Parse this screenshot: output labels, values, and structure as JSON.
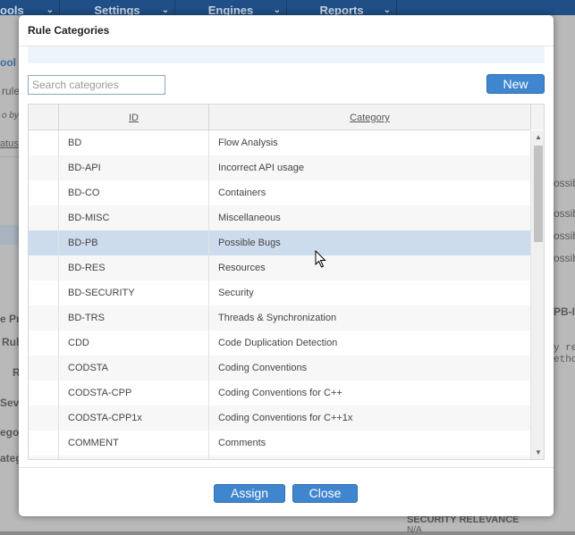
{
  "background": {
    "nav_items": [
      {
        "label": "ools"
      },
      {
        "label": "Settings"
      },
      {
        "label": "Engines"
      },
      {
        "label": "Reports"
      }
    ],
    "left_fragments": [
      "ool fi",
      "rule",
      "o by",
      "atus",
      "e Pr",
      "Rul",
      "R",
      "Sev",
      "egor",
      "ateg"
    ],
    "right_fragments": [
      "ossib",
      "ossib",
      "ossib",
      "ossib",
      "PB-IN",
      "y re",
      "etho",
      "SECURITY RELEVANCE",
      "N/A"
    ]
  },
  "modal": {
    "title": "Rule Categories",
    "search": {
      "placeholder": "Search categories",
      "value": ""
    },
    "new_button": "New",
    "assign_button": "Assign",
    "close_button": "Close",
    "columns": {
      "id": "ID",
      "category": "Category"
    },
    "rows": [
      {
        "id": "BD",
        "category": "Flow Analysis",
        "selected": false
      },
      {
        "id": "BD-API",
        "category": "Incorrect API usage",
        "selected": false
      },
      {
        "id": "BD-CO",
        "category": "Containers",
        "selected": false
      },
      {
        "id": "BD-MISC",
        "category": "Miscellaneous",
        "selected": false
      },
      {
        "id": "BD-PB",
        "category": "Possible Bugs",
        "selected": true
      },
      {
        "id": "BD-RES",
        "category": "Resources",
        "selected": false
      },
      {
        "id": "BD-SECURITY",
        "category": "Security",
        "selected": false
      },
      {
        "id": "BD-TRS",
        "category": "Threads & Synchronization",
        "selected": false
      },
      {
        "id": "CDD",
        "category": "Code Duplication Detection",
        "selected": false
      },
      {
        "id": "CODSTA",
        "category": "Coding Conventions",
        "selected": false
      },
      {
        "id": "CODSTA-CPP",
        "category": "Coding Conventions for C++",
        "selected": false
      },
      {
        "id": "CODSTA-CPP1x",
        "category": "Coding Conventions for C++1x",
        "selected": false
      },
      {
        "id": "COMMENT",
        "category": "Comments",
        "selected": false
      },
      {
        "id": "",
        "category": "",
        "selected": false
      }
    ]
  },
  "colors": {
    "accent": "#3f86cf",
    "selected_row": "#cddced",
    "nav": "#1f4f86"
  }
}
